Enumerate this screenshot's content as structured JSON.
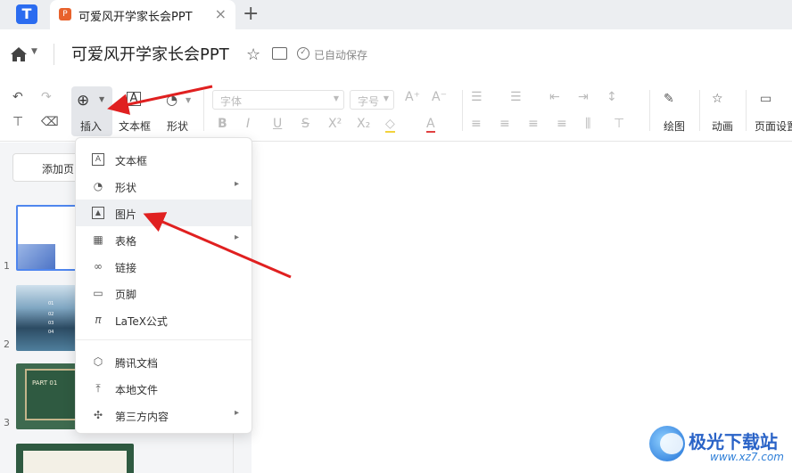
{
  "tab": {
    "title": "可爱风开学家长会PPT",
    "close": "×",
    "add": "+"
  },
  "header": {
    "doc_title": "可爱风开学家长会PPT",
    "autosave": "已自动保存"
  },
  "toolbar": {
    "insert": "插入",
    "textbox": "文本框",
    "shape": "形状",
    "font_placeholder": "字体",
    "size_placeholder": "字号",
    "draw": "绘图",
    "animation": "动画",
    "page_setup": "页面设置"
  },
  "left": {
    "add_page": "添加页",
    "slide_numbers": [
      "1",
      "2",
      "3"
    ]
  },
  "menu": {
    "items": [
      {
        "label": "文本框",
        "icon": "textbox-icon",
        "submenu": false
      },
      {
        "label": "形状",
        "icon": "shape-icon",
        "submenu": true
      },
      {
        "label": "图片",
        "icon": "image-icon",
        "submenu": false
      },
      {
        "label": "表格",
        "icon": "table-icon",
        "submenu": true
      },
      {
        "label": "链接",
        "icon": "link-icon",
        "submenu": false
      },
      {
        "label": "页脚",
        "icon": "footer-icon",
        "submenu": false
      },
      {
        "label": "LaTeX公式",
        "icon": "pi-icon",
        "submenu": false
      },
      {
        "label": "腾讯文档",
        "icon": "tencent-doc-icon",
        "submenu": false
      },
      {
        "label": "本地文件",
        "icon": "upload-icon",
        "submenu": false
      },
      {
        "label": "第三方内容",
        "icon": "puzzle-icon",
        "submenu": true
      }
    ],
    "hovered": "图片"
  },
  "watermark": {
    "title": "极光下载站",
    "url": "www.xz7.com"
  },
  "colors": {
    "accent": "#2b6cf0",
    "arrow": "#e02020",
    "tab_icon": "#e8622c"
  }
}
